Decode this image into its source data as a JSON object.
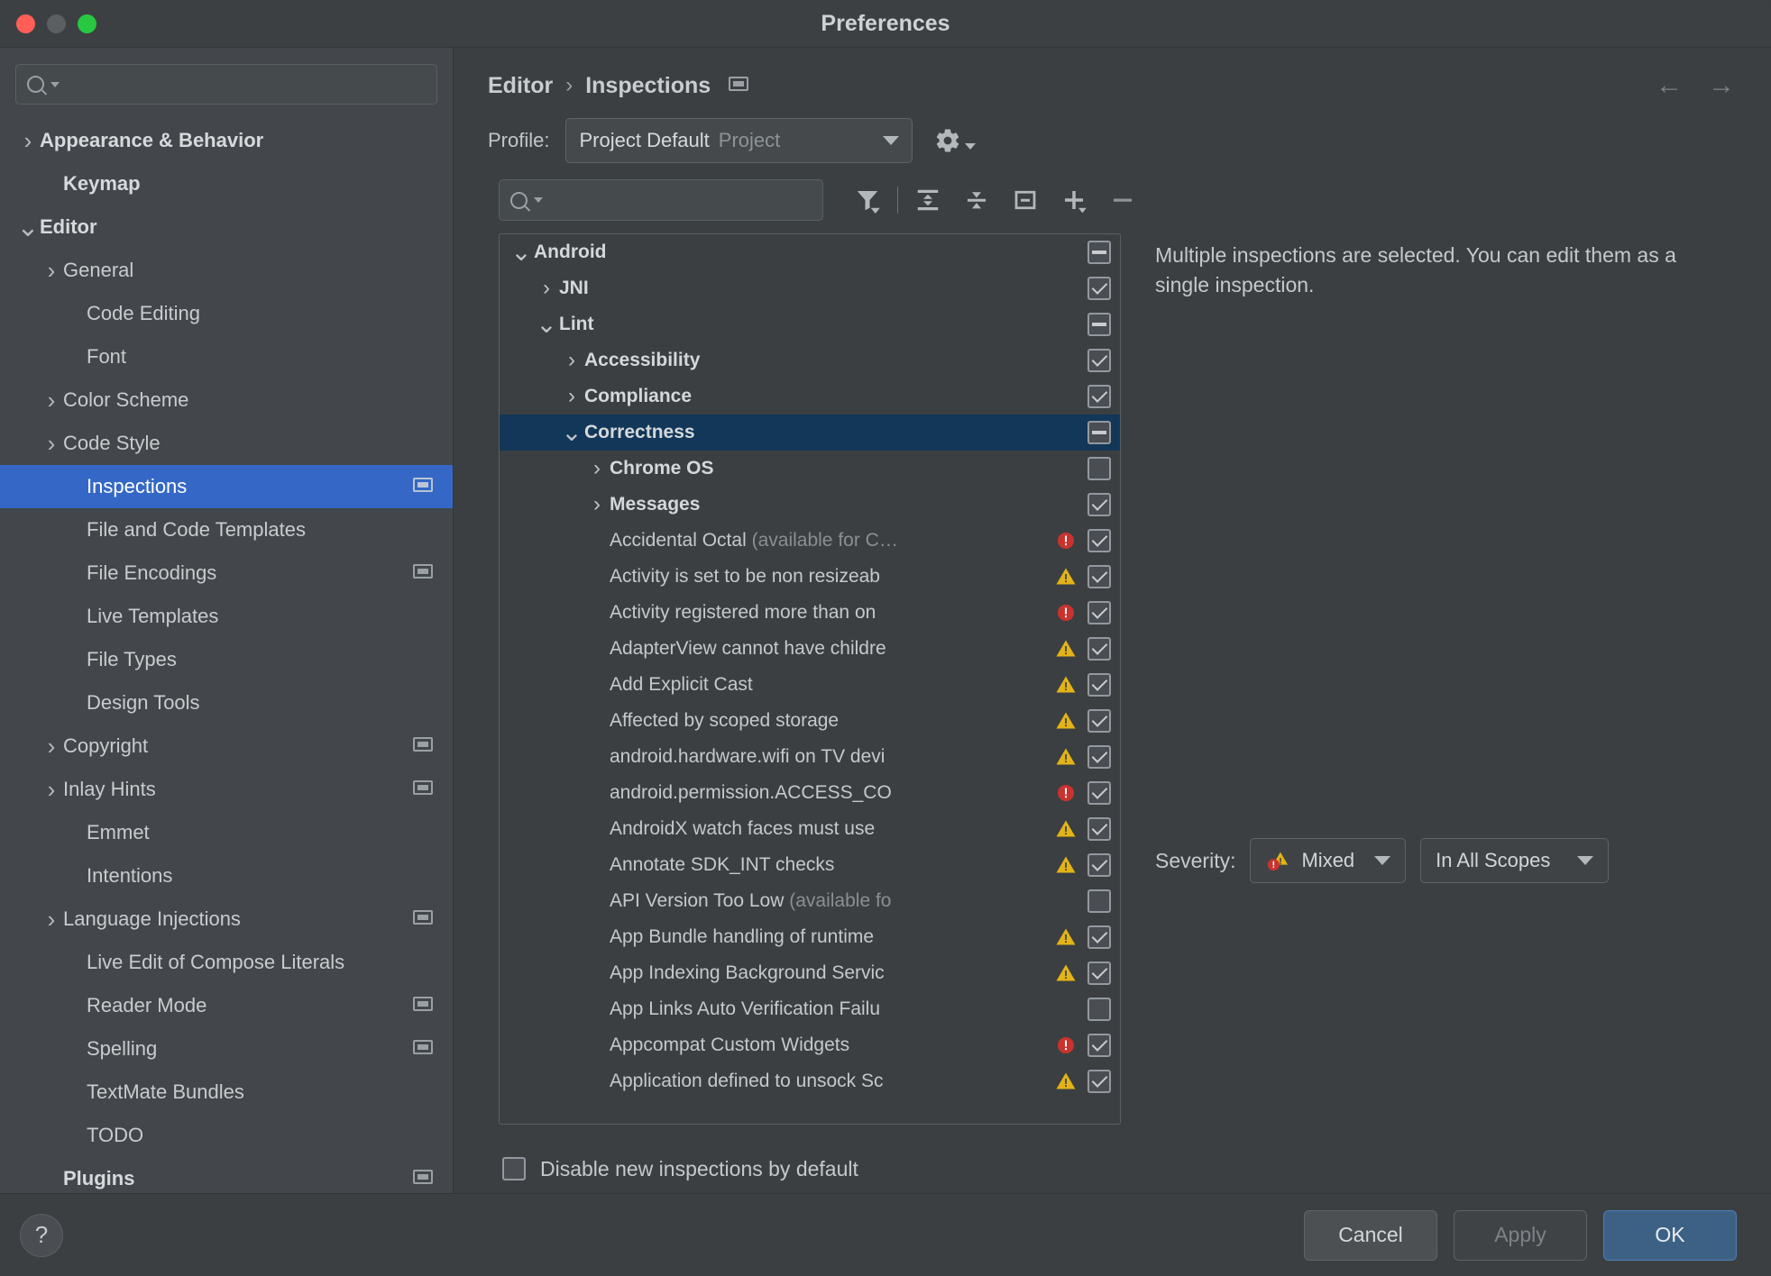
{
  "window": {
    "title": "Preferences",
    "controls": [
      "close",
      "minimize",
      "zoom"
    ]
  },
  "sidebar": {
    "search": {
      "value": "",
      "placeholder": ""
    },
    "items": [
      {
        "label": "Appearance & Behavior",
        "arrow": "collapsed",
        "indent": 0,
        "bold": true,
        "selected": false,
        "badge": false
      },
      {
        "label": "Keymap",
        "arrow": "none",
        "indent": 1,
        "bold": true,
        "selected": false,
        "badge": false
      },
      {
        "label": "Editor",
        "arrow": "expanded",
        "indent": 0,
        "bold": true,
        "selected": false,
        "badge": false
      },
      {
        "label": "General",
        "arrow": "collapsed",
        "indent": 1,
        "bold": false,
        "selected": false,
        "badge": false
      },
      {
        "label": "Code Editing",
        "arrow": "none",
        "indent": 2,
        "bold": false,
        "selected": false,
        "badge": false
      },
      {
        "label": "Font",
        "arrow": "none",
        "indent": 2,
        "bold": false,
        "selected": false,
        "badge": false
      },
      {
        "label": "Color Scheme",
        "arrow": "collapsed",
        "indent": 1,
        "bold": false,
        "selected": false,
        "badge": false
      },
      {
        "label": "Code Style",
        "arrow": "collapsed",
        "indent": 1,
        "bold": false,
        "selected": false,
        "badge": false
      },
      {
        "label": "Inspections",
        "arrow": "none",
        "indent": 2,
        "bold": false,
        "selected": true,
        "badge": true
      },
      {
        "label": "File and Code Templates",
        "arrow": "none",
        "indent": 2,
        "bold": false,
        "selected": false,
        "badge": false
      },
      {
        "label": "File Encodings",
        "arrow": "none",
        "indent": 2,
        "bold": false,
        "selected": false,
        "badge": true
      },
      {
        "label": "Live Templates",
        "arrow": "none",
        "indent": 2,
        "bold": false,
        "selected": false,
        "badge": false
      },
      {
        "label": "File Types",
        "arrow": "none",
        "indent": 2,
        "bold": false,
        "selected": false,
        "badge": false
      },
      {
        "label": "Design Tools",
        "arrow": "none",
        "indent": 2,
        "bold": false,
        "selected": false,
        "badge": false
      },
      {
        "label": "Copyright",
        "arrow": "collapsed",
        "indent": 1,
        "bold": false,
        "selected": false,
        "badge": true
      },
      {
        "label": "Inlay Hints",
        "arrow": "collapsed",
        "indent": 1,
        "bold": false,
        "selected": false,
        "badge": true
      },
      {
        "label": "Emmet",
        "arrow": "none",
        "indent": 2,
        "bold": false,
        "selected": false,
        "badge": false
      },
      {
        "label": "Intentions",
        "arrow": "none",
        "indent": 2,
        "bold": false,
        "selected": false,
        "badge": false
      },
      {
        "label": "Language Injections",
        "arrow": "collapsed",
        "indent": 1,
        "bold": false,
        "selected": false,
        "badge": true
      },
      {
        "label": "Live Edit of Compose Literals",
        "arrow": "none",
        "indent": 2,
        "bold": false,
        "selected": false,
        "badge": false
      },
      {
        "label": "Reader Mode",
        "arrow": "none",
        "indent": 2,
        "bold": false,
        "selected": false,
        "badge": true
      },
      {
        "label": "Spelling",
        "arrow": "none",
        "indent": 2,
        "bold": false,
        "selected": false,
        "badge": true
      },
      {
        "label": "TextMate Bundles",
        "arrow": "none",
        "indent": 2,
        "bold": false,
        "selected": false,
        "badge": false
      },
      {
        "label": "TODO",
        "arrow": "none",
        "indent": 2,
        "bold": false,
        "selected": false,
        "badge": false
      },
      {
        "label": "Plugins",
        "arrow": "none",
        "indent": 1,
        "bold": true,
        "selected": false,
        "badge": true
      }
    ]
  },
  "header": {
    "breadcrumb": {
      "parent": "Editor",
      "separator": "›",
      "current": "Inspections"
    },
    "nav_back": "←",
    "nav_forward": "→"
  },
  "profile": {
    "label": "Profile:",
    "value": "Project Default",
    "scope": "Project",
    "gear_icon": "gear-icon"
  },
  "toolbar": {
    "search": {
      "value": "",
      "placeholder": ""
    },
    "buttons": [
      {
        "name": "filter-inspections",
        "icon": "filter-icon"
      },
      {
        "name": "expand-all",
        "icon": "expand-all-icon"
      },
      {
        "name": "collapse-all",
        "icon": "collapse-all-icon"
      },
      {
        "name": "reset-to-empty",
        "icon": "boxed-minus-icon"
      },
      {
        "name": "add-scope",
        "icon": "plus-icon"
      },
      {
        "name": "remove-scope",
        "icon": "minus-icon"
      }
    ]
  },
  "tree": {
    "rows": [
      {
        "label": "Android",
        "dim": "",
        "indent": 0,
        "arrow": "expanded",
        "group": true,
        "check": "partial",
        "severity": "none",
        "selected": false
      },
      {
        "label": "JNI",
        "dim": "",
        "indent": 1,
        "arrow": "collapsed",
        "group": true,
        "check": "checked",
        "severity": "none",
        "selected": false
      },
      {
        "label": "Lint",
        "dim": "",
        "indent": 1,
        "arrow": "expanded",
        "group": true,
        "check": "partial",
        "severity": "none",
        "selected": false
      },
      {
        "label": "Accessibility",
        "dim": "",
        "indent": 2,
        "arrow": "collapsed",
        "group": true,
        "check": "checked",
        "severity": "none",
        "selected": false
      },
      {
        "label": "Compliance",
        "dim": "",
        "indent": 2,
        "arrow": "collapsed",
        "group": true,
        "check": "checked",
        "severity": "none",
        "selected": false
      },
      {
        "label": "Correctness",
        "dim": "",
        "indent": 2,
        "arrow": "expanded",
        "group": true,
        "check": "partial",
        "severity": "none",
        "selected": true
      },
      {
        "label": "Chrome OS",
        "dim": "",
        "indent": 3,
        "arrow": "collapsed",
        "group": true,
        "check": "unchecked",
        "severity": "none",
        "selected": false
      },
      {
        "label": "Messages",
        "dim": "",
        "indent": 3,
        "arrow": "collapsed",
        "group": true,
        "check": "checked",
        "severity": "none",
        "selected": false
      },
      {
        "label": "Accidental Octal",
        "dim": "(available for C…",
        "indent": 3,
        "arrow": "none",
        "group": false,
        "check": "checked",
        "severity": "error",
        "selected": false
      },
      {
        "label": "Activity is set to be non resizeab",
        "dim": "",
        "indent": 3,
        "arrow": "none",
        "group": false,
        "check": "checked",
        "severity": "warning",
        "selected": false
      },
      {
        "label": "Activity registered more than on",
        "dim": "",
        "indent": 3,
        "arrow": "none",
        "group": false,
        "check": "checked",
        "severity": "error",
        "selected": false
      },
      {
        "label": "AdapterView cannot have childre",
        "dim": "",
        "indent": 3,
        "arrow": "none",
        "group": false,
        "check": "checked",
        "severity": "warning",
        "selected": false
      },
      {
        "label": "Add Explicit Cast",
        "dim": "",
        "indent": 3,
        "arrow": "none",
        "group": false,
        "check": "checked",
        "severity": "warning",
        "selected": false
      },
      {
        "label": "Affected by scoped storage",
        "dim": "",
        "indent": 3,
        "arrow": "none",
        "group": false,
        "check": "checked",
        "severity": "warning",
        "selected": false
      },
      {
        "label": "android.hardware.wifi on TV devi",
        "dim": "",
        "indent": 3,
        "arrow": "none",
        "group": false,
        "check": "checked",
        "severity": "warning",
        "selected": false
      },
      {
        "label": "android.permission.ACCESS_CO",
        "dim": "",
        "indent": 3,
        "arrow": "none",
        "group": false,
        "check": "checked",
        "severity": "error",
        "selected": false
      },
      {
        "label": "AndroidX watch faces must use ",
        "dim": "",
        "indent": 3,
        "arrow": "none",
        "group": false,
        "check": "checked",
        "severity": "warning",
        "selected": false
      },
      {
        "label": "Annotate SDK_INT checks",
        "dim": "",
        "indent": 3,
        "arrow": "none",
        "group": false,
        "check": "checked",
        "severity": "warning",
        "selected": false
      },
      {
        "label": "API Version Too Low",
        "dim": "(available fo",
        "indent": 3,
        "arrow": "none",
        "group": false,
        "check": "unchecked",
        "severity": "none",
        "selected": false
      },
      {
        "label": "App Bundle handling of runtime ",
        "dim": "",
        "indent": 3,
        "arrow": "none",
        "group": false,
        "check": "checked",
        "severity": "warning",
        "selected": false
      },
      {
        "label": "App Indexing Background Servic",
        "dim": "",
        "indent": 3,
        "arrow": "none",
        "group": false,
        "check": "checked",
        "severity": "warning",
        "selected": false
      },
      {
        "label": "App Links Auto Verification Failu",
        "dim": "",
        "indent": 3,
        "arrow": "none",
        "group": false,
        "check": "unchecked",
        "severity": "none",
        "selected": false
      },
      {
        "label": "Appcompat Custom Widgets",
        "dim": "",
        "indent": 3,
        "arrow": "none",
        "group": false,
        "check": "checked",
        "severity": "error",
        "selected": false
      },
      {
        "label": "Application defined to unsock Sc",
        "dim": "",
        "indent": 3,
        "arrow": "none",
        "group": false,
        "check": "checked",
        "severity": "warning",
        "selected": false
      }
    ]
  },
  "right_panel": {
    "message": "Multiple inspections are selected. You can edit them as a single inspection.",
    "severity_label": "Severity:",
    "severity_value": "Mixed",
    "severity_icon": "mixed-severity-icon",
    "scope_value": "In All Scopes"
  },
  "footer": {
    "disable_new_label": "Disable new inspections by default",
    "disable_new_checked": false
  },
  "buttons": {
    "help": "?",
    "cancel": "Cancel",
    "apply": "Apply",
    "apply_disabled": true,
    "ok": "OK"
  },
  "colors": {
    "accent_blue": "#3568c6",
    "selection_tree": "#123758",
    "ok_button": "#3d6185",
    "error_red": "#c9332e",
    "warning_yellow": "#e3b317",
    "window_bg": "#3c3f41",
    "sidebar_bg": "#43474b"
  }
}
